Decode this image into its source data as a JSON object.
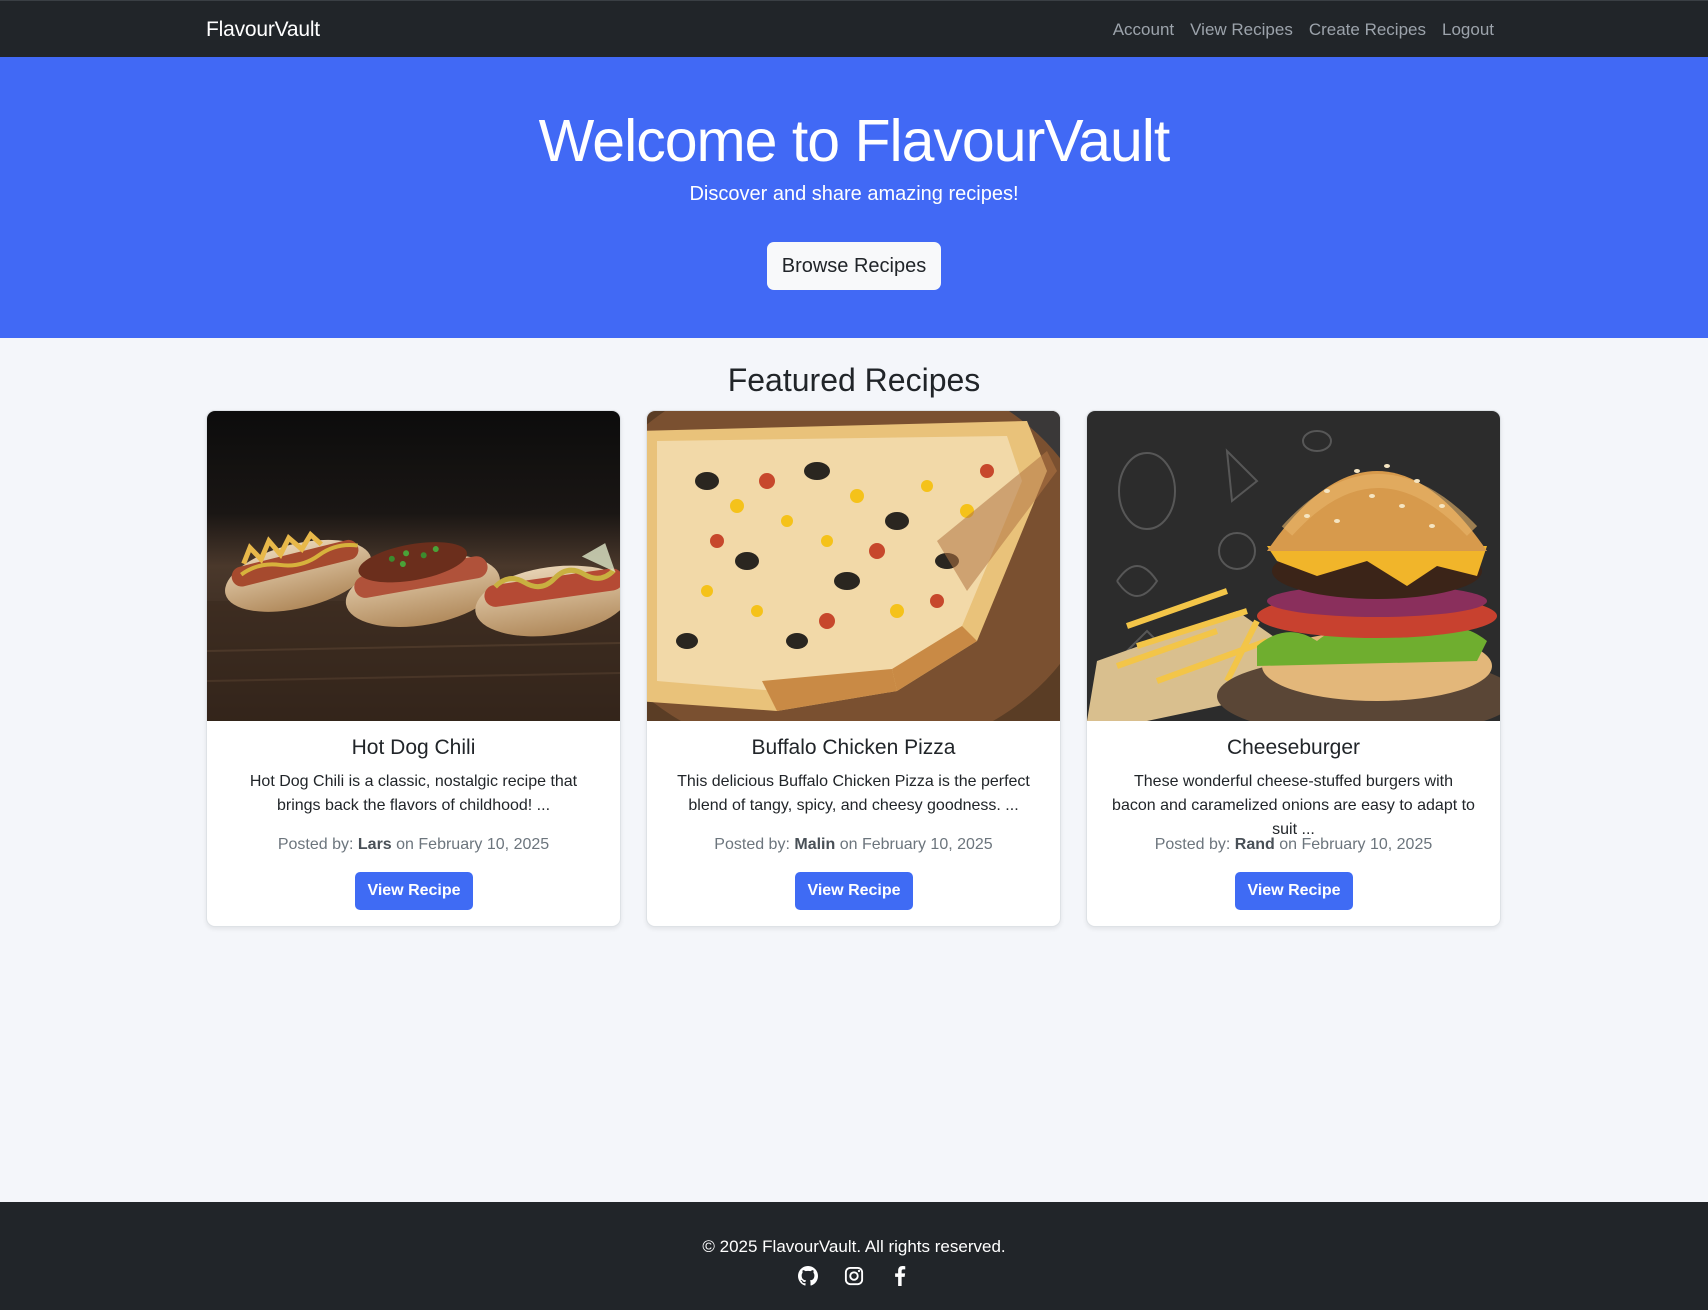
{
  "nav": {
    "brand": "FlavourVault",
    "links": [
      "Account",
      "View Recipes",
      "Create Recipes",
      "Logout"
    ]
  },
  "hero": {
    "title": "Welcome to FlavourVault",
    "subtitle": "Discover and share amazing recipes!",
    "button": "Browse Recipes"
  },
  "featured": {
    "title": "Featured Recipes",
    "posted_by_label": "Posted by:",
    "on_label": "on",
    "cards": [
      {
        "title": "Hot Dog Chili",
        "description": "Hot Dog Chili is a classic, nostalgic recipe that brings back the flavors of childhood! ...",
        "author": "Lars",
        "date": "February 10, 2025",
        "button": "View Recipe",
        "image": "hot-dogs-photo"
      },
      {
        "title": "Buffalo Chicken Pizza",
        "description": "This delicious Buffalo Chicken Pizza is the perfect blend of tangy, spicy, and cheesy goodness. ...",
        "author": "Malin",
        "date": "February 10, 2025",
        "button": "View Recipe",
        "image": "pizza-photo"
      },
      {
        "title": "Cheeseburger",
        "description": "These wonderful cheese-stuffed burgers with bacon and caramelized onions are easy to adapt to suit ...",
        "author": "Rand",
        "date": "February 10, 2025",
        "button": "View Recipe",
        "image": "cheeseburger-photo"
      }
    ]
  },
  "footer": {
    "copyright": "© 2025 FlavourVault. All rights reserved.",
    "social_icons": [
      "github-icon",
      "instagram-icon",
      "facebook-icon"
    ]
  },
  "colors": {
    "navbar": "#212529",
    "hero": "#4169f5",
    "primary_button": "#3f6bf4",
    "page_background": "#f4f6fa",
    "footer": "#212529"
  }
}
